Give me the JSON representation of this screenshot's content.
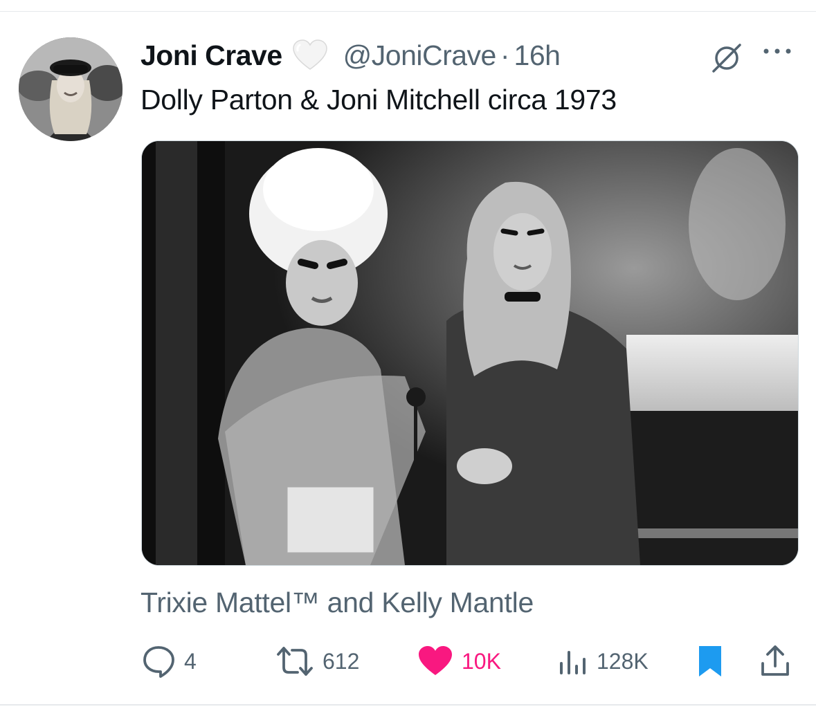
{
  "tweet": {
    "author_name": "Joni Crave",
    "author_handle": "@JoniCrave",
    "separator": "·",
    "time": "16h",
    "text": "Dolly Parton & Joni Mitchell circa 1973",
    "media_caption": "Trixie Mattel™ and Kelly Mantle"
  },
  "actions": {
    "replies": "4",
    "retweets": "612",
    "likes": "10K",
    "views": "128K"
  },
  "icons": {
    "badge": "white-heart-icon",
    "grok": "grok-icon",
    "more": "more-icon",
    "reply": "reply-icon",
    "retweet": "retweet-icon",
    "like": "heart-icon",
    "views": "views-icon",
    "bookmark": "bookmark-icon",
    "share": "share-icon"
  },
  "colors": {
    "text_primary": "#0f1419",
    "text_secondary": "#536471",
    "like_active": "#f91880",
    "bookmark_active": "#1d9bf0"
  }
}
